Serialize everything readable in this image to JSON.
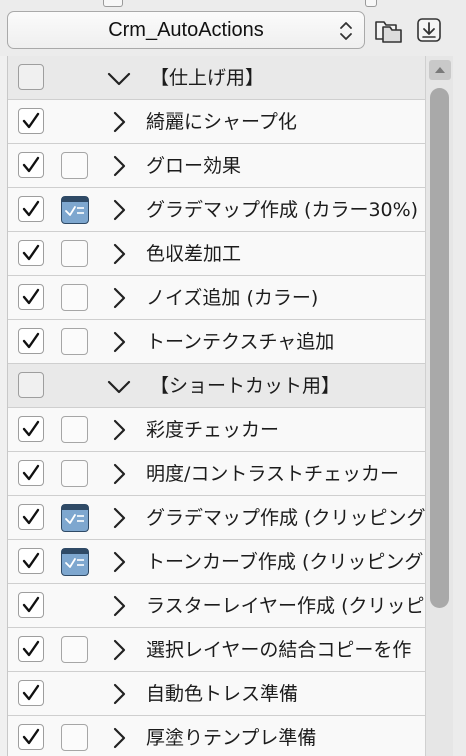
{
  "header": {
    "action_set": "Crm_AutoActions",
    "folder_icon": "folder-duplicate-icon",
    "import_icon": "import-download-icon"
  },
  "actions": [
    {
      "label": "【仕上げ用】",
      "group": true,
      "enabled": false,
      "expanded": true
    },
    {
      "label": "綺麗にシャープ化",
      "group": false,
      "enabled": true,
      "dialog": null
    },
    {
      "label": "グロー効果",
      "group": false,
      "enabled": true,
      "dialog": false
    },
    {
      "label": "グラデマップ作成 (カラー30%)",
      "group": false,
      "enabled": true,
      "dialog": true
    },
    {
      "label": "色収差加工",
      "group": false,
      "enabled": true,
      "dialog": false
    },
    {
      "label": "ノイズ追加 (カラー)",
      "group": false,
      "enabled": true,
      "dialog": false
    },
    {
      "label": "トーンテクスチャ追加",
      "group": false,
      "enabled": true,
      "dialog": false
    },
    {
      "label": "【ショートカット用】",
      "group": true,
      "enabled": false,
      "expanded": true
    },
    {
      "label": "彩度チェッカー",
      "group": false,
      "enabled": true,
      "dialog": false
    },
    {
      "label": "明度/コントラストチェッカー",
      "group": false,
      "enabled": true,
      "dialog": false
    },
    {
      "label": "グラデマップ作成 (クリッピング",
      "group": false,
      "enabled": true,
      "dialog": true
    },
    {
      "label": "トーンカーブ作成 (クリッピング",
      "group": false,
      "enabled": true,
      "dialog": true
    },
    {
      "label": "ラスターレイヤー作成 (クリッピ",
      "group": false,
      "enabled": true,
      "dialog": null
    },
    {
      "label": "選択レイヤーの結合コピーを作",
      "group": false,
      "enabled": true,
      "dialog": false
    },
    {
      "label": "自動色トレス準備",
      "group": false,
      "enabled": true,
      "dialog": null
    },
    {
      "label": "厚塗りテンプレ準備",
      "group": false,
      "enabled": true,
      "dialog": false
    }
  ],
  "scrollbar": {
    "position_fraction": 0.0,
    "visible_fraction": 0.78
  }
}
